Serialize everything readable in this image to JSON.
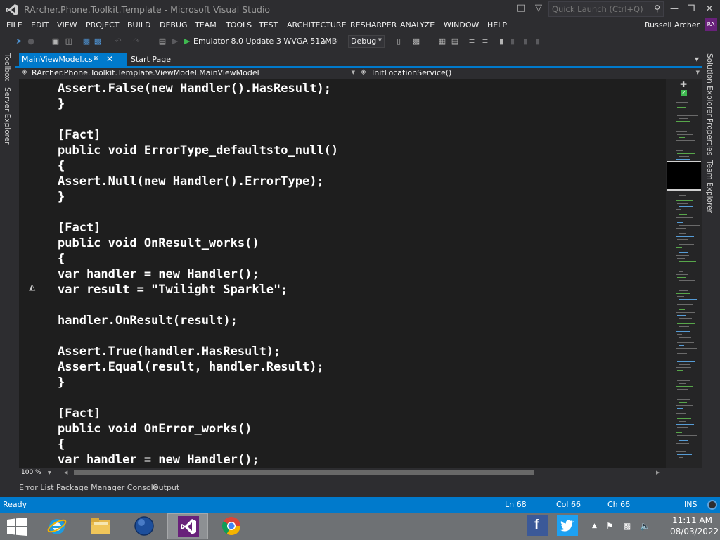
{
  "window": {
    "title": "RArcher.Phone.Toolkit.Template - Microsoft Visual Studio",
    "quick_launch_placeholder": "Quick Launch (Ctrl+Q)"
  },
  "menu": {
    "items": [
      "FILE",
      "EDIT",
      "VIEW",
      "PROJECT",
      "BUILD",
      "DEBUG",
      "TEAM",
      "TOOLS",
      "TEST",
      "ARCHITECTURE",
      "RESHARPER",
      "ANALYZE",
      "WINDOW",
      "HELP"
    ],
    "user_name": "Russell Archer",
    "user_initials": "RA"
  },
  "toolbar": {
    "run_target": "Emulator 8.0 Update 3 WVGA 512MB",
    "configuration": "Debug"
  },
  "side_tabs": {
    "left": [
      "Toolbox",
      "Server Explorer"
    ],
    "right": [
      "Solution Explorer",
      "Properties",
      "Team Explorer"
    ]
  },
  "tabs": {
    "active": "MainViewModel.cs",
    "inactive": "Start Page"
  },
  "navbar": {
    "type_path": "RArcher.Phone.Toolkit.Template.ViewModel.MainViewModel",
    "member": "InitLocationService()"
  },
  "code_lines": [
    "Assert.False(new Handler().HasResult);",
    "}",
    "",
    "[Fact]",
    "public void ErrorType_defaultsto_null()",
    "{",
    "Assert.Null(new Handler().ErrorType);",
    "}",
    "",
    "[Fact]",
    "public void OnResult_works()",
    "{",
    "var handler = new Handler();",
    "var result = \"Twilight Sparkle\";",
    "",
    "handler.OnResult(result);",
    "",
    "Assert.True(handler.HasResult);",
    "Assert.Equal(result, handler.Result);",
    "}",
    "",
    "[Fact]",
    "public void OnError_works()",
    "{",
    "var handler = new Handler();"
  ],
  "editor": {
    "zoom": "100 %"
  },
  "bottom_tabs": [
    "Error List",
    "Package Manager Console",
    "Output"
  ],
  "status": {
    "state": "Ready",
    "line": "Ln 68",
    "column": "Col 66",
    "char": "Ch 66",
    "mode": "INS"
  },
  "taskbar": {
    "apps": [
      "internet-explorer",
      "file-explorer",
      "windows-media",
      "visual-studio",
      "chrome"
    ],
    "time": "11:11 AM",
    "date": "08/03/2022"
  },
  "colors": {
    "accent": "#007acc",
    "editor_bg": "#1e1e1e",
    "chrome_bg": "#2d2d30",
    "vs_purple": "#68217a"
  }
}
